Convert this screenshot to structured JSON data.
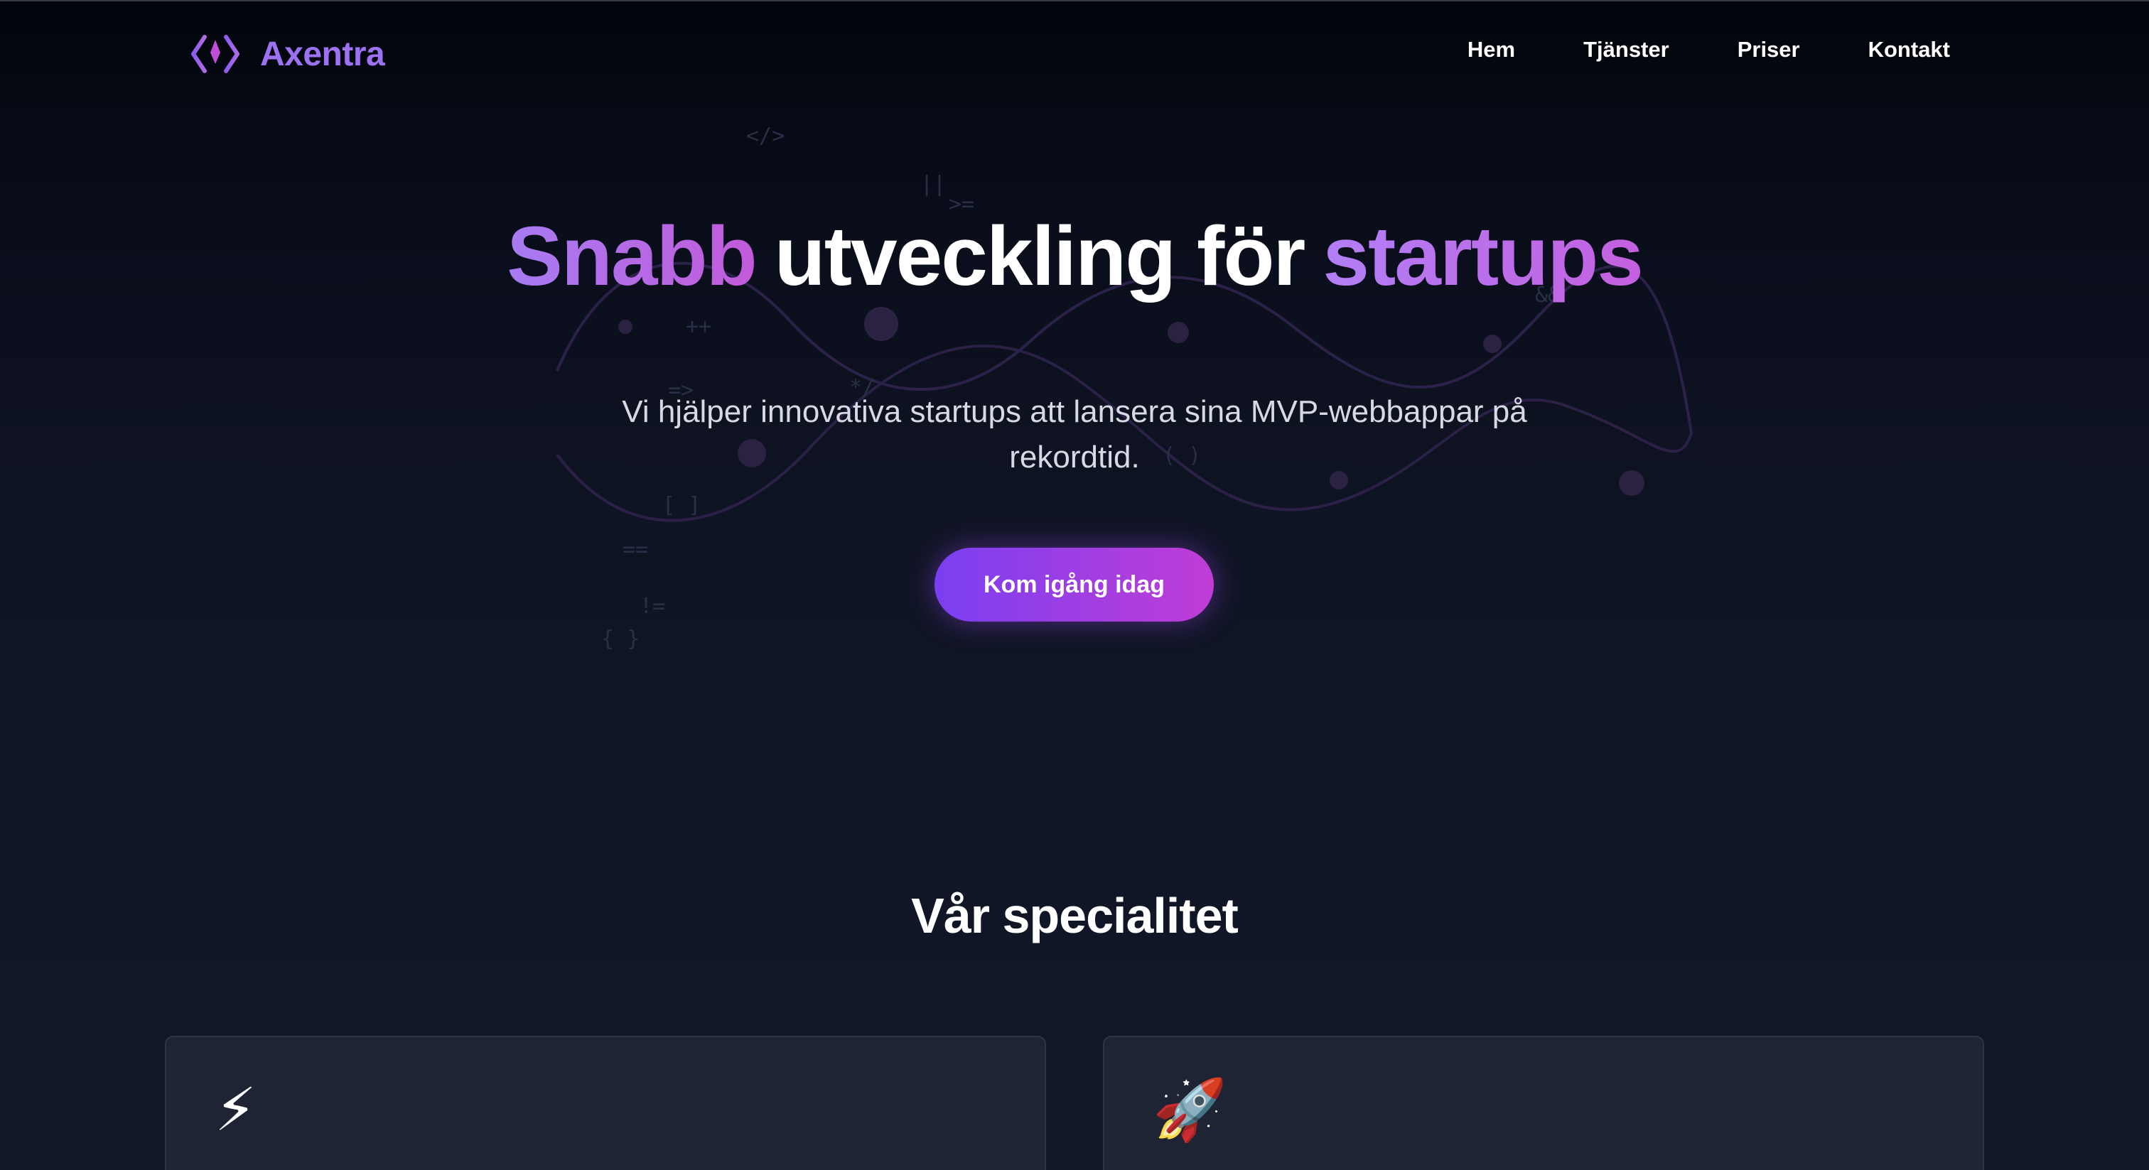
{
  "brand": {
    "name": "Axentra",
    "accent": "#9d72f2"
  },
  "nav": {
    "items": [
      "Hem",
      "Tjänster",
      "Priser",
      "Kontakt"
    ]
  },
  "hero": {
    "title_part1": "Snabb",
    "title_part2": "utveckling för",
    "title_part3": "startups",
    "subtitle": "Vi hjälper innovativa startups att lansera sina MVP-webbappar på rekordtid.",
    "cta_label": "Kom igång idag",
    "code_symbols": [
      "</>",
      "||",
      ">=",
      "++",
      "*/",
      "[ ]",
      "==",
      "!=",
      "{ }",
      "( )",
      "&&",
      "=>"
    ]
  },
  "specialties": {
    "title": "Vår specialitet",
    "cards": [
      {
        "icon": "⚡",
        "icon_name": "lightning-icon"
      },
      {
        "icon": "🚀",
        "icon_name": "rocket-icon"
      }
    ]
  },
  "colors": {
    "background": "#0f1424",
    "gradient_start": "#7a3ff0",
    "gradient_end": "#c03dd6",
    "card_bg": "#1e2433"
  }
}
